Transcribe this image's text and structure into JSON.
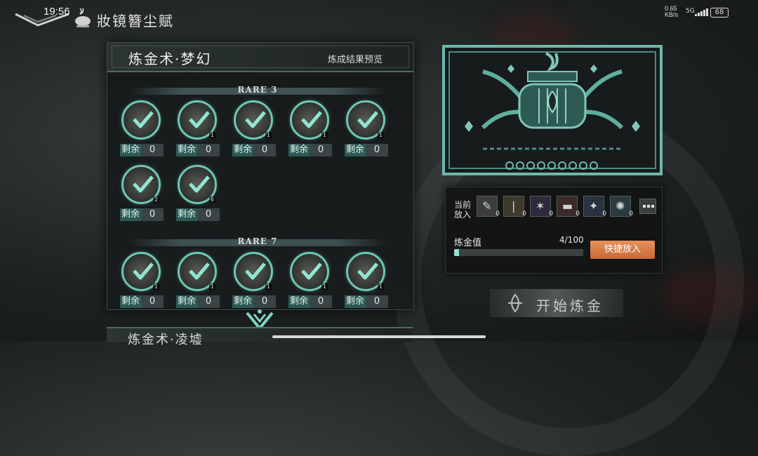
{
  "status_bar": {
    "time": "19:56",
    "net_speed": "0.65",
    "net_unit": "KB/s",
    "signal": "5G",
    "battery": "68"
  },
  "header": {
    "title": "妝镜簪尘赋"
  },
  "left_panel": {
    "title": "炼金术·梦幻",
    "preview_link": "炼成结果预览",
    "remain_label": "剩余",
    "groups": [
      {
        "rare": "RARE 3",
        "items": [
          {
            "count": "",
            "remain": "0"
          },
          {
            "count": "1",
            "remain": "0"
          },
          {
            "count": "1",
            "remain": "0"
          },
          {
            "count": "1",
            "remain": "0"
          },
          {
            "count": "1",
            "remain": "0"
          },
          {
            "count": "2",
            "remain": "0"
          },
          {
            "count": "6",
            "remain": "0"
          }
        ]
      },
      {
        "rare": "RARE 7",
        "items": [
          {
            "count": "1",
            "remain": "0"
          },
          {
            "count": "1",
            "remain": "0"
          },
          {
            "count": "1",
            "remain": "0"
          },
          {
            "count": "1",
            "remain": "0"
          },
          {
            "count": "1",
            "remain": "0"
          }
        ]
      }
    ],
    "next_section_title": "炼金术·凌墟"
  },
  "right_panel": {
    "placed_label": "当前放入",
    "slots": [
      {
        "icon": "wrench-icon",
        "count": "0"
      },
      {
        "icon": "blades-icon",
        "count": "0"
      },
      {
        "icon": "beetle-icon",
        "count": "0"
      },
      {
        "icon": "red-part-icon",
        "count": "0"
      },
      {
        "icon": "blue-shard-icon",
        "count": "0"
      },
      {
        "icon": "crystal-icon",
        "count": "0"
      }
    ],
    "value_label": "炼金值",
    "value_text": "4/100",
    "value_fraction": 0.04,
    "quick_add_label": "快捷放入"
  },
  "start_button": {
    "label": "开始炼金"
  },
  "colors": {
    "accent": "#6fc7b5",
    "remain_bg": "#2c5a55",
    "quick_btn": "#e0824c"
  }
}
